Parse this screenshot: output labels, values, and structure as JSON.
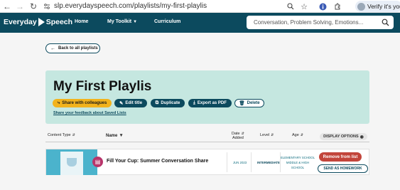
{
  "browser": {
    "url": "slp.everydayspeech.com/playlists/my-first-playlis",
    "profile_label": "Verify it's you"
  },
  "site": {
    "logo_part1": "Everyday",
    "logo_part2": "Speech",
    "nav": {
      "home": "Home",
      "toolkit": "My Toolkit",
      "curriculum": "Curriculum"
    },
    "search_placeholder": "Conversation, Problem Solving, Emotions..."
  },
  "back_label": "Back to all playlists",
  "playlist": {
    "title": "My First Playlis",
    "actions": {
      "share": "Share with colleagues",
      "edit": "Edit title",
      "duplicate": "Duplicate",
      "export": "Export as PDF",
      "delete": "Delete"
    },
    "feedback_link": "Share your feedback about Saved Lists"
  },
  "table": {
    "headers": {
      "content_type": "Content Type",
      "name": "Name",
      "date_added_1": "Date",
      "date_added_2": "Added",
      "level": "Level",
      "age": "Age",
      "display_options": "DISPLAY OPTIONS"
    },
    "rows": [
      {
        "title": "Fill Your Cup: Summer Conversation Share",
        "date": "JUN 2023",
        "level": "INTERMEDIATE",
        "age_1": "ELEMENTARY SCHOOL",
        "age_2": "MIDDLE & HIGH",
        "age_3": "SCHOOL",
        "remove_label": "Remove  from list",
        "homework_label": "SEND AS HOMEWORK"
      }
    ]
  },
  "colors": {
    "brand_dark": "#0c4a5e",
    "hero_bg": "#c5e7e0",
    "share_yellow": "#f2b31c",
    "remove_red": "#c2453b",
    "doc_icon_pink": "#b8356b"
  }
}
